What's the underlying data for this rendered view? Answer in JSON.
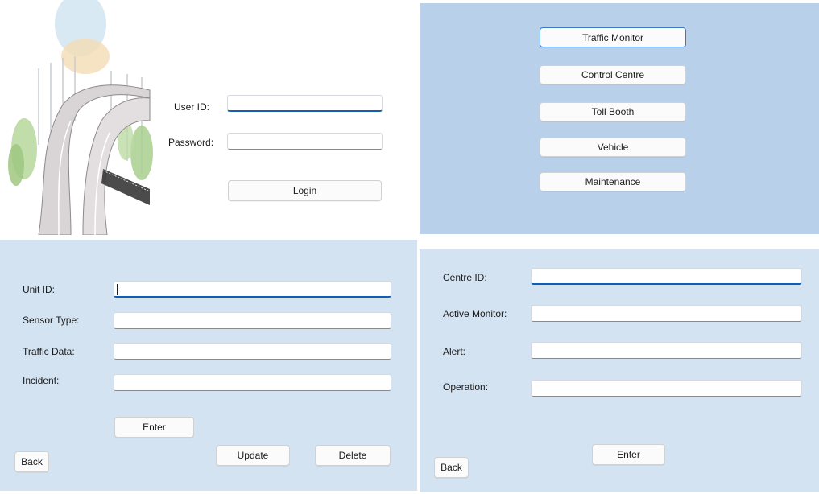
{
  "login": {
    "user_id_label": "User ID:",
    "user_id_value": "",
    "password_label": "Password:",
    "password_value": "",
    "login_button": "Login"
  },
  "menu": {
    "items": [
      {
        "label": "Traffic Monitor"
      },
      {
        "label": "Control Centre"
      },
      {
        "label": "Toll Booth"
      },
      {
        "label": "Vehicle"
      },
      {
        "label": "Maintenance"
      }
    ]
  },
  "traffic_monitor": {
    "unit_id_label": "Unit ID:",
    "unit_id_value": "",
    "sensor_type_label": "Sensor Type:",
    "sensor_type_value": "",
    "traffic_data_label": "Traffic Data:",
    "traffic_data_value": "",
    "incident_label": "Incident:",
    "incident_value": "",
    "enter_button": "Enter",
    "update_button": "Update",
    "delete_button": "Delete",
    "back_button": "Back"
  },
  "control_centre": {
    "centre_id_label": "Centre ID:",
    "centre_id_value": "",
    "active_monitor_label": "Active Monitor:",
    "active_monitor_value": "",
    "alert_label": "Alert:",
    "alert_value": "",
    "operation_label": "Operation:",
    "operation_value": "",
    "enter_button": "Enter",
    "back_button": "Back"
  },
  "colors": {
    "menu_panel_bg": "#b9d0ea",
    "form_panel_bg": "#d4e3f1",
    "focus_accent": "#0f5fb8"
  },
  "icons": {
    "login_illustration": "highway-road-illustration"
  }
}
